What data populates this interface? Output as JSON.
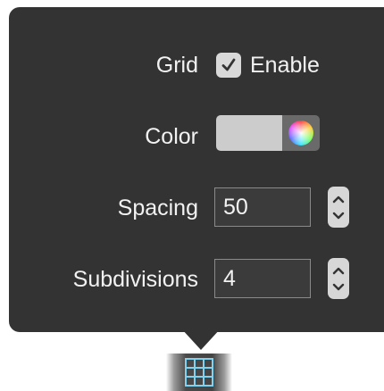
{
  "popover": {
    "grid_label": "Grid",
    "enable_label": "Enable",
    "enable_checked": true,
    "color_label": "Color",
    "color_value": "#cccccc",
    "spacing_label": "Spacing",
    "spacing_value": "50",
    "subdivisions_label": "Subdivisions",
    "subdivisions_value": "4"
  },
  "icons": {
    "checkmark": "checkmark-icon",
    "color_wheel": "color-wheel-icon",
    "stepper_up": "chevron-up-icon",
    "stepper_down": "chevron-down-icon",
    "grid_button": "grid-icon"
  },
  "colors": {
    "popover_background": "#333333",
    "text": "#f2f2f2",
    "grid_icon": "#7fd3f0"
  }
}
